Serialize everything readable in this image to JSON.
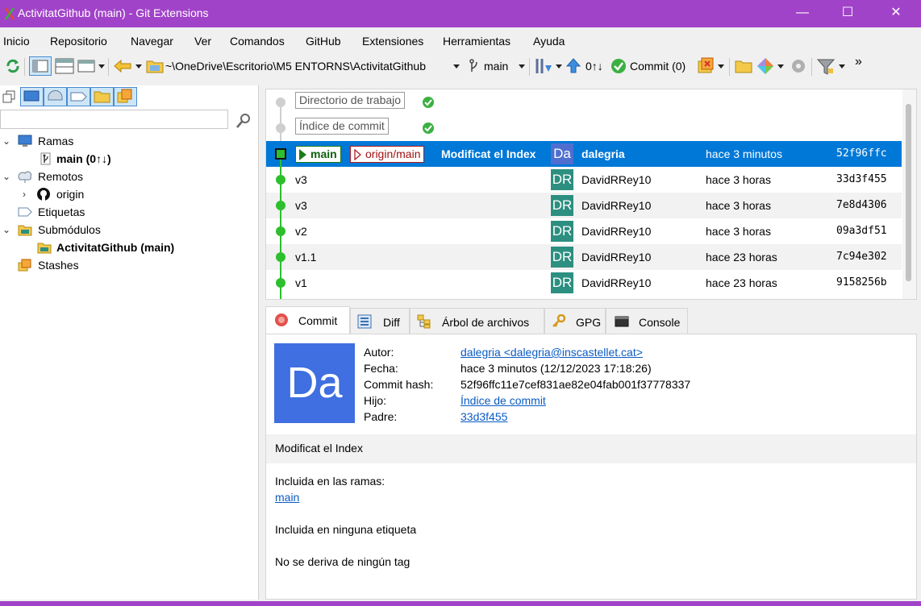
{
  "window": {
    "title": "ActivitatGithub (main) - Git Extensions",
    "minimize_glyph": "—",
    "maximize_glyph": "☐",
    "close_glyph": "✕",
    "accent": "#a143c9"
  },
  "menu": [
    "Inicio",
    "Repositorio",
    "Navegar",
    "Ver",
    "Comandos",
    "GitHub",
    "Extensiones",
    "Herramientas",
    "Ayuda"
  ],
  "toolbar": {
    "path": "~\\OneDrive\\Escritorio\\M5 ENTORNS\\ActivitatGithub",
    "branch": "main",
    "sync_status": "0↑↓",
    "commit_label": "Commit (0)",
    "overflow": "»"
  },
  "sidebar": {
    "search_placeholder": "",
    "tree": {
      "branches_label": "Ramas",
      "main_branch": "main (0↑↓)",
      "remotes_label": "Remotos",
      "origin": "origin",
      "tags_label": "Etiquetas",
      "submodules_label": "Submódulos",
      "submodule_item": "ActivitatGithub (main)",
      "stashes_label": "Stashes"
    }
  },
  "graph": {
    "working_dir": "Directorio de trabajo",
    "index": "Índice de commit",
    "head_ref": "main",
    "remote_ref": "origin/main",
    "commits": [
      {
        "message": "Modificat el Index",
        "initials": "Da",
        "author": "dalegria",
        "date": "hace 3 minutos",
        "hash": "52f96ffc"
      },
      {
        "message": "v3",
        "initials": "DR",
        "author": "DavidRRey10",
        "date": "hace 3 horas",
        "hash": "33d3f455"
      },
      {
        "message": "v3",
        "initials": "DR",
        "author": "DavidRRey10",
        "date": "hace 3 horas",
        "hash": "7e8d4306"
      },
      {
        "message": "v2",
        "initials": "DR",
        "author": "DavidRRey10",
        "date": "hace 3 horas",
        "hash": "09a3df51"
      },
      {
        "message": "v1.1",
        "initials": "DR",
        "author": "DavidRRey10",
        "date": "hace 23 horas",
        "hash": "7c94e302"
      },
      {
        "message": "v1",
        "initials": "DR",
        "author": "DavidRRey10",
        "date": "hace 23 horas",
        "hash": "9158256b"
      }
    ]
  },
  "tabs": [
    "Commit",
    "Diff",
    "Árbol de archivos",
    "GPG",
    "Console"
  ],
  "details": {
    "avatar_initials": "Da",
    "author_label": "Autor:",
    "author_value": "dalegria <dalegria@inscastellet.cat>",
    "date_label": "Fecha:",
    "date_value": "hace 3 minutos (12/12/2023 17:18:26)",
    "hash_label": "Commit hash:",
    "hash_value": "52f96ffc11e7cef831ae82e04fab001f37778337",
    "child_label": "Hijo:",
    "child_value": "Índice de commit",
    "parent_label": "Padre:",
    "parent_value": "33d3f455",
    "message": "Modificat el Index",
    "branches_heading": "Incluida en las ramas:",
    "branch_link": "main",
    "tags_text": "Incluida en ninguna etiqueta",
    "derive_text": "No se deriva de ningún tag"
  }
}
